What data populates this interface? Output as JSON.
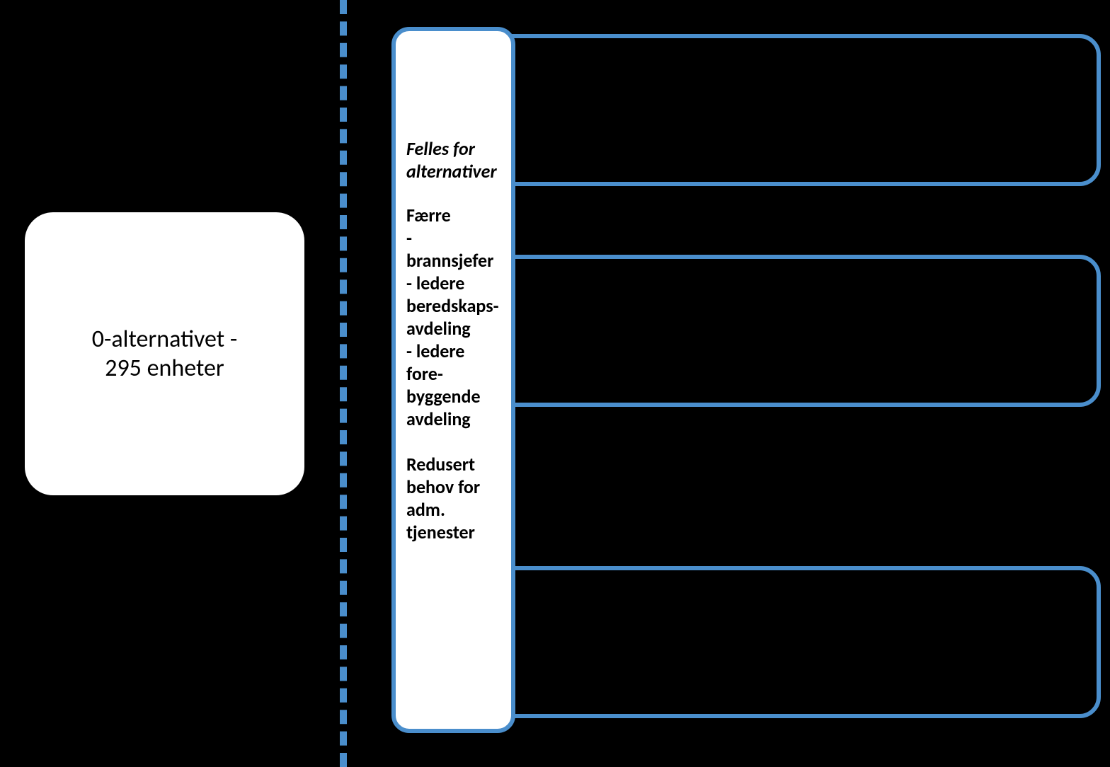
{
  "left": {
    "line1": "0-alternativet -",
    "line2": "295 enheter"
  },
  "common": {
    "header1": "Felles for",
    "header2": "alternativer",
    "section1_title": "Færre",
    "section1_item1": "- brannsjefer",
    "section1_item2": "- ledere",
    "section1_item3": "beredskaps-",
    "section1_item4": "avdeling",
    "section1_item5": "- ledere fore-",
    "section1_item6": "byggende",
    "section1_item7": "avdeling",
    "section2_line1": "Redusert",
    "section2_line2": "behov for",
    "section2_line3": "adm.",
    "section2_line4": "tjenester"
  }
}
